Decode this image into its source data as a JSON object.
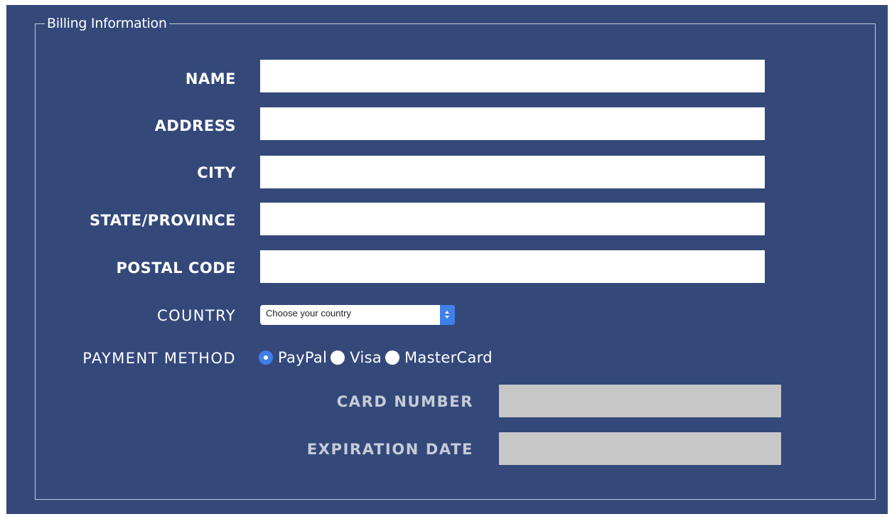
{
  "form": {
    "legend": "Billing Information",
    "fields": {
      "name": {
        "label": "NAME",
        "value": ""
      },
      "address": {
        "label": "ADDRESS",
        "value": ""
      },
      "city": {
        "label": "CITY",
        "value": ""
      },
      "state": {
        "label": "STATE/PROVINCE",
        "value": ""
      },
      "postal": {
        "label": "POSTAL CODE",
        "value": ""
      }
    },
    "country": {
      "label": "COUNTRY",
      "selected": "Choose your country"
    },
    "payment": {
      "label": "PAYMENT METHOD",
      "options": [
        "PayPal",
        "Visa",
        "MasterCard"
      ],
      "selected": "PayPal"
    },
    "card_number": {
      "label": "CARD NUMBER",
      "value": ""
    },
    "expiration": {
      "label": "EXPIRATION DATE",
      "value": ""
    }
  },
  "colors": {
    "background": "#34497a",
    "accent": "#3f7fe8",
    "disabled_field": "#c7c7c7"
  }
}
